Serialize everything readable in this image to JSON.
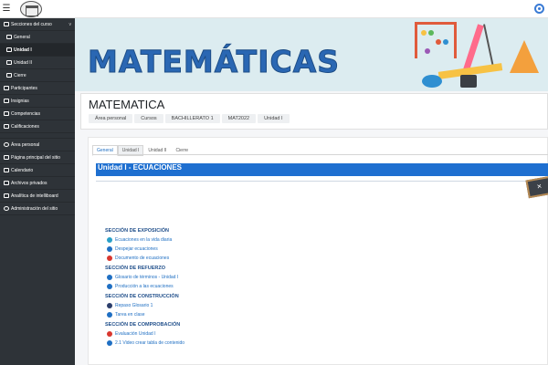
{
  "topbar": {
    "menu_icon": "hamburger-icon",
    "logo": "site-logo",
    "settings_icon": "gear-icon",
    "accent": "#3a7bd5"
  },
  "drawer": {
    "items": [
      {
        "label": "Secciones del curso",
        "icon": "folder-icon",
        "sub": false,
        "active": false
      },
      {
        "label": "General",
        "icon": "folder-icon",
        "sub": true,
        "active": false
      },
      {
        "label": "Unidad I",
        "icon": "folder-icon",
        "sub": true,
        "active": true
      },
      {
        "label": "Unidad II",
        "icon": "folder-icon",
        "sub": true,
        "active": false
      },
      {
        "label": "Cierre",
        "icon": "folder-icon",
        "sub": true,
        "active": false
      },
      {
        "label": "Participantes",
        "icon": "users-icon",
        "sub": false,
        "active": false
      },
      {
        "label": "Insignias",
        "icon": "badge-icon",
        "sub": false,
        "active": false
      },
      {
        "label": "Competencias",
        "icon": "check-icon",
        "sub": false,
        "active": false
      },
      {
        "label": "Calificaciones",
        "icon": "table-icon",
        "sub": false,
        "active": false
      },
      {
        "label": "Área personal",
        "icon": "dashboard-icon",
        "sub": false,
        "active": false
      },
      {
        "label": "Página principal del sitio",
        "icon": "home-icon",
        "sub": false,
        "active": false
      },
      {
        "label": "Calendario",
        "icon": "calendar-icon",
        "sub": false,
        "active": false
      },
      {
        "label": "Archivos privados",
        "icon": "file-icon",
        "sub": false,
        "active": false
      },
      {
        "label": "Analítica de intelliboard",
        "icon": "analytics-icon",
        "sub": false,
        "active": false
      },
      {
        "label": "Administración del sitio",
        "icon": "cog-icon",
        "sub": false,
        "active": false
      }
    ],
    "chevron": "v",
    "bg": "#2e3338"
  },
  "banner": {
    "title": "MATEMÁTICAS",
    "bg": "#dcecf0",
    "title_color": "#2a67b3"
  },
  "header": {
    "course_title": "MATEMATICA",
    "breadcrumb": [
      "Área personal",
      "Cursos",
      "BACHILLERATO 1",
      "MAT2022",
      "Unidad I"
    ]
  },
  "tabs": [
    {
      "label": "General",
      "state": "active"
    },
    {
      "label": "Unidad I",
      "state": "sel"
    },
    {
      "label": "Unidad II",
      "state": ""
    },
    {
      "label": "Cierre",
      "state": ""
    }
  ],
  "unit": {
    "title": "Unidad I - ECUACIONES",
    "color": "#1e6fd0"
  },
  "sections": [
    {
      "title": "SECCIÓN DE EXPOSICIÓN",
      "activities": [
        {
          "label": "Ecuaciones en la vida diaria",
          "color": "#2aa0c8"
        },
        {
          "label": "Despejar ecuaciones",
          "color": "#1f6fc3"
        },
        {
          "label": "Documento de ecuaciones",
          "color": "#d9372f"
        }
      ]
    },
    {
      "title": "SECCIÓN DE REFUERZO",
      "activities": [
        {
          "label": "Glosario de términos - Unidad I",
          "color": "#1f6fc3"
        },
        {
          "label": "Producción a las ecuaciones",
          "color": "#1f6fc3"
        }
      ]
    },
    {
      "title": "SECCIÓN DE CONSTRUCCIÓN",
      "activities": [
        {
          "label": "Repaso Glosario 1",
          "color": "#2c3e6b"
        },
        {
          "label": "Tarea en clase",
          "color": "#1f6fc3"
        }
      ]
    },
    {
      "title": "SECCIÓN DE COMPROBACIÓN",
      "activities": [
        {
          "label": "Evaluación Unidad I",
          "color": "#d9372f"
        },
        {
          "label": "2.1 Video crear tabla de contenido",
          "color": "#1f6fc3"
        }
      ]
    }
  ]
}
